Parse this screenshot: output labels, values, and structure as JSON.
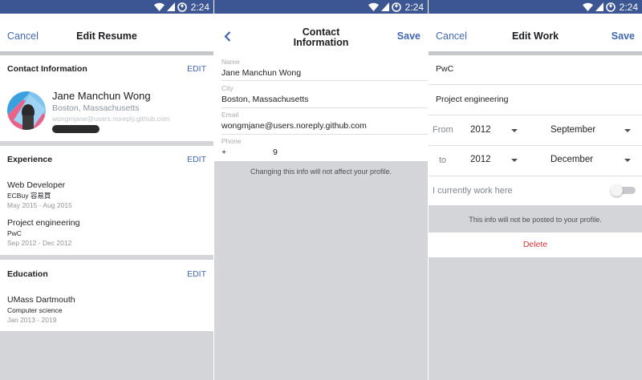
{
  "status_bar": {
    "time": "2:24",
    "icons": [
      "wifi-icon",
      "signal-icon",
      "data-saver-icon"
    ]
  },
  "colors": {
    "status_bar": "#3b5693",
    "accent": "#4267b2",
    "delete": "#e0333a",
    "background": "#d4d5d9"
  },
  "edit_resume": {
    "nav": {
      "left": "Cancel",
      "title": "Edit Resume"
    },
    "contact": {
      "heading": "Contact Information",
      "edit": "EDIT",
      "name": "Jane Manchun Wong",
      "location": "Boston, Massachusetts",
      "email": "wongmjane@users.noreply.github.com"
    },
    "experience": {
      "heading": "Experience",
      "edit": "EDIT",
      "items": [
        {
          "title": "Web Developer",
          "company": "ECBuy 容易買",
          "dates": "May 2015 - Aug 2015"
        },
        {
          "title": "Project engineering",
          "company": "PwC",
          "dates": "Sep 2012 - Dec 2012"
        }
      ]
    },
    "education": {
      "heading": "Education",
      "edit": "EDIT",
      "items": [
        {
          "school": "UMass Dartmouth",
          "field": "Computer science",
          "dates": "Jan 2013 - 2019"
        }
      ]
    }
  },
  "contact_info": {
    "nav": {
      "title_line1": "Contact",
      "title_line2": "Information",
      "right": "Save",
      "back_icon": "chevron-left-icon"
    },
    "fields": [
      {
        "label": "Name",
        "value": "Jane Manchun Wong"
      },
      {
        "label": "City",
        "value": "Boston, Massachusetts"
      },
      {
        "label": "Email",
        "value": "wongmjane@users.noreply.github.com"
      },
      {
        "label": "Phone",
        "value_prefix": "+",
        "value_suffix": "9"
      }
    ],
    "note": "Changing this info will not affect your profile."
  },
  "edit_work": {
    "nav": {
      "left": "Cancel",
      "title": "Edit Work",
      "right": "Save"
    },
    "company": "PwC",
    "position": "Project engineering",
    "from": {
      "label": "From",
      "year": "2012",
      "month": "September"
    },
    "to": {
      "label": "to",
      "year": "2012",
      "month": "December"
    },
    "current": {
      "label": "I currently work here",
      "on": false
    },
    "note": "This info will not be posted to your profile.",
    "delete": "Delete"
  }
}
